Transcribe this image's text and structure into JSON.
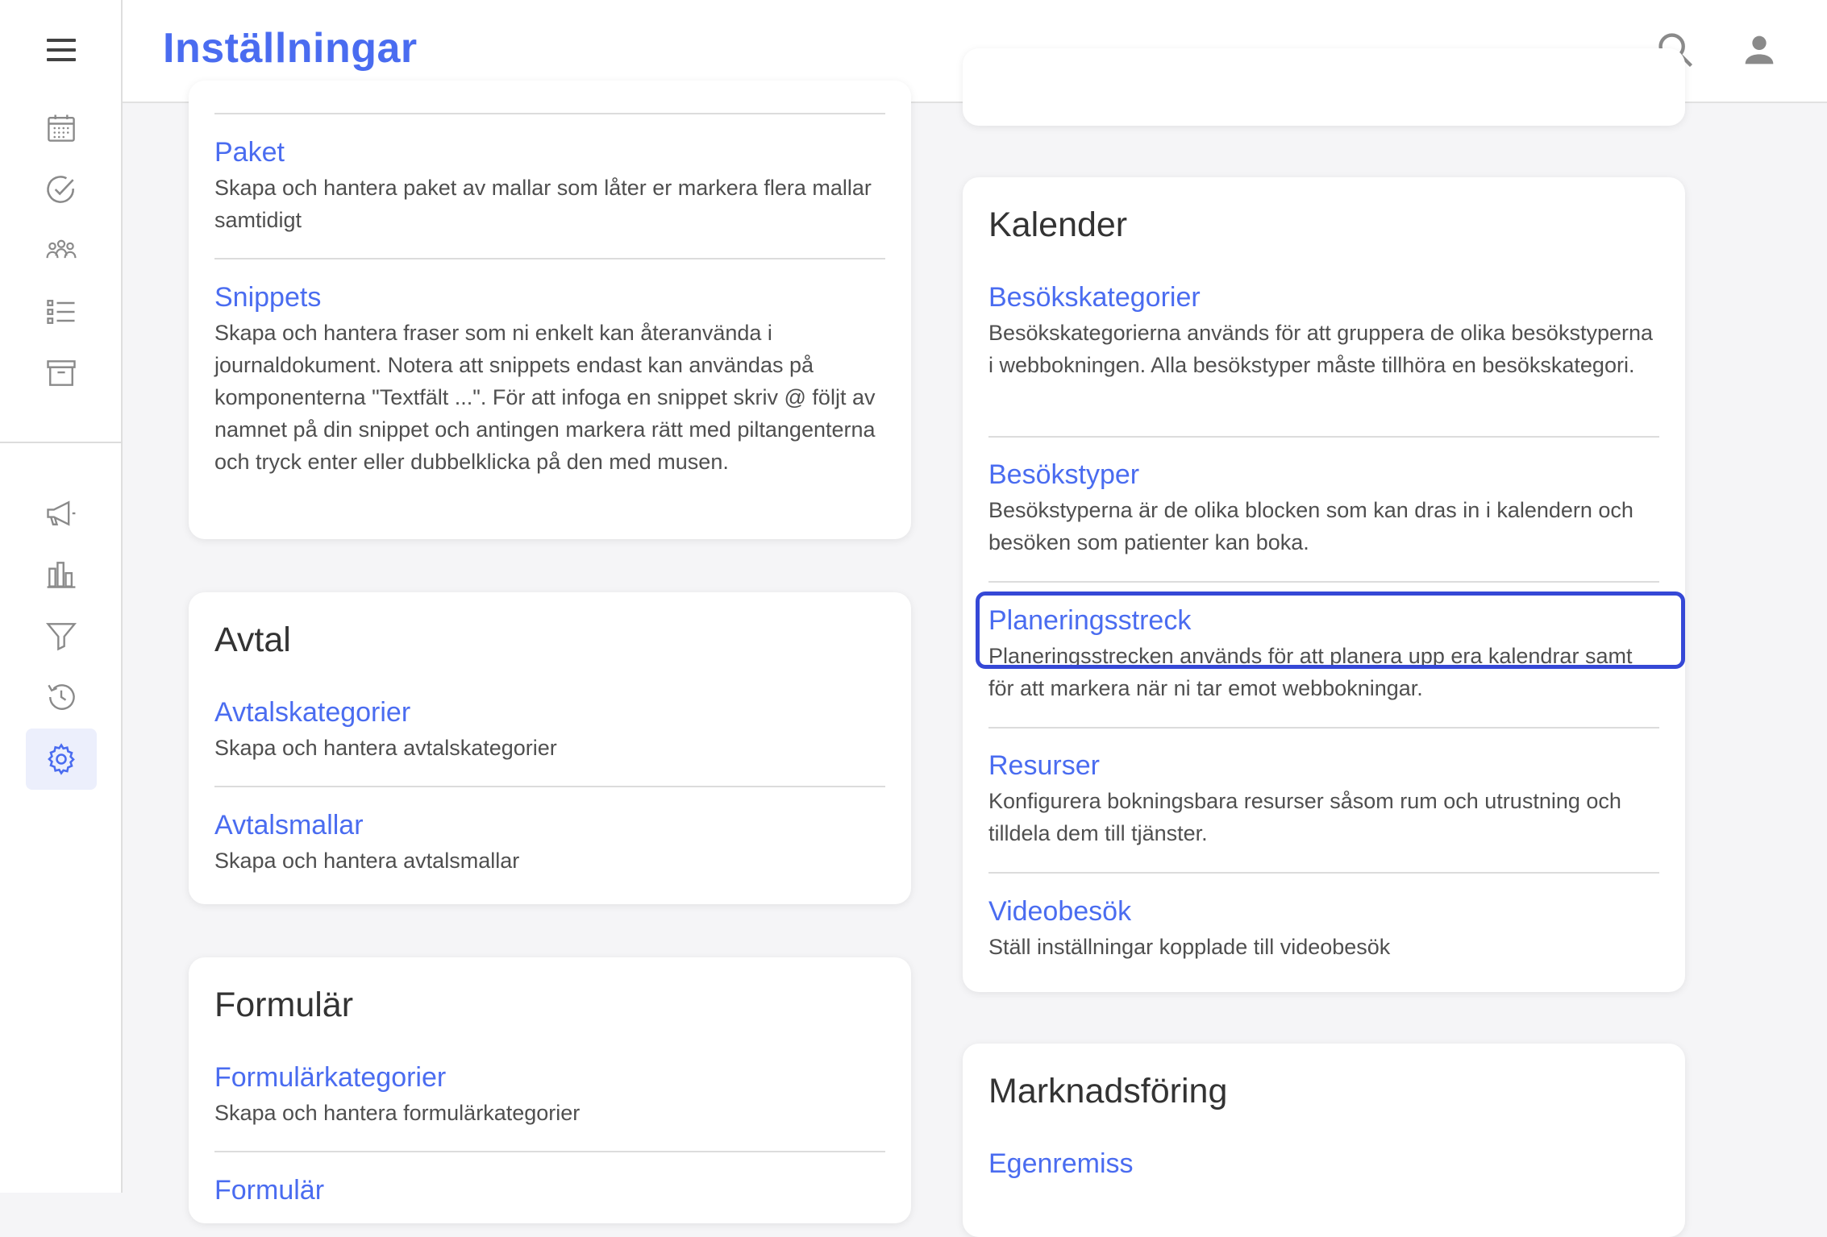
{
  "header": {
    "title": "Inställningar",
    "search_icon": "search-icon",
    "account_icon": "account-icon"
  },
  "sidebar": {
    "menu_icon": "hamburger-menu-icon",
    "items": [
      {
        "icon": "calendar-icon"
      },
      {
        "icon": "check-circle-icon"
      },
      {
        "icon": "patients-group-icon"
      },
      {
        "icon": "list-icon"
      },
      {
        "icon": "archive-icon"
      },
      {
        "icon": "megaphone-icon"
      },
      {
        "icon": "bar-chart-icon"
      },
      {
        "icon": "filter-icon"
      },
      {
        "icon": "history-icon"
      },
      {
        "icon": "settings-gear-icon",
        "active": true
      }
    ]
  },
  "left_cards": {
    "templates": {
      "items": [
        {
          "label": "Paket",
          "description": "Skapa och hantera paket av mallar som låter er markera flera mallar samtidigt"
        },
        {
          "label": "Snippets",
          "description": "Skapa och hantera fraser som ni enkelt kan återanvända i journaldokument. Notera att snippets endast kan användas på komponenterna \"Textfält ...\". För att infoga en snippet skriv @ följt av namnet på din snippet och antingen markera rätt med piltangenterna och tryck enter eller dubbelklicka på den med musen."
        }
      ]
    },
    "avtal": {
      "title": "Avtal",
      "items": [
        {
          "label": "Avtalskategorier",
          "description": "Skapa och hantera avtalskategorier"
        },
        {
          "label": "Avtalsmallar",
          "description": "Skapa och hantera avtalsmallar"
        }
      ]
    },
    "formular": {
      "title": "Formulär",
      "items": [
        {
          "label": "Formulärkategorier",
          "description": "Skapa och hantera formulärkategorier"
        },
        {
          "label": "Formulär",
          "description": ""
        }
      ]
    }
  },
  "right_cards": {
    "kalender": {
      "title": "Kalender",
      "items": [
        {
          "label": "Besökskategorier",
          "description": "Besökskategorierna används för att gruppera de olika besökstyperna i webbokningen. Alla besökstyper måste tillhöra en besökskategori."
        },
        {
          "label": "Besökstyper",
          "description": "Besökstyperna är de olika blocken som kan dras in i kalendern och besöken som patienter kan boka."
        },
        {
          "label": "Planeringsstreck",
          "description": "Planeringsstrecken används för att planera upp era kalendrar samt för att markera när ni tar emot webbokningar.",
          "highlighted": true
        },
        {
          "label": "Resurser",
          "description": "Konfigurera bokningsbara resurser såsom rum och utrustning och tilldela dem till tjänster."
        },
        {
          "label": "Videobesök",
          "description": "Ställ inställningar kopplade till videobesök"
        }
      ]
    },
    "marknadsforing": {
      "title": "Marknadsföring",
      "items": [
        {
          "label": "Egenremiss",
          "description": ""
        }
      ]
    }
  },
  "colors": {
    "accent": "#4a6cf0",
    "highlight_border": "#3548d6",
    "background": "#f5f5f7"
  }
}
